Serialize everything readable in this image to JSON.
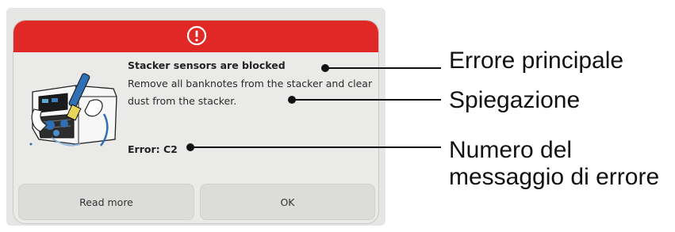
{
  "dialog": {
    "alert_icon": "exclamation-circle-icon",
    "title": "Stacker sensors are blocked",
    "message": "Remove all banknotes from the stacker and clear dust from the stacker.",
    "error_code": "Error: C2",
    "buttons": {
      "read_more": "Read more",
      "ok": "OK"
    }
  },
  "annotations": {
    "main_error": "Errore principale",
    "explanation": "Spiegazione",
    "error_number_line1": "Numero del",
    "error_number_line2": "messaggio di errore"
  },
  "colors": {
    "header_red": "#e02827",
    "dialog_bg": "#eaeae9",
    "button_bg": "#dcdcdb"
  }
}
